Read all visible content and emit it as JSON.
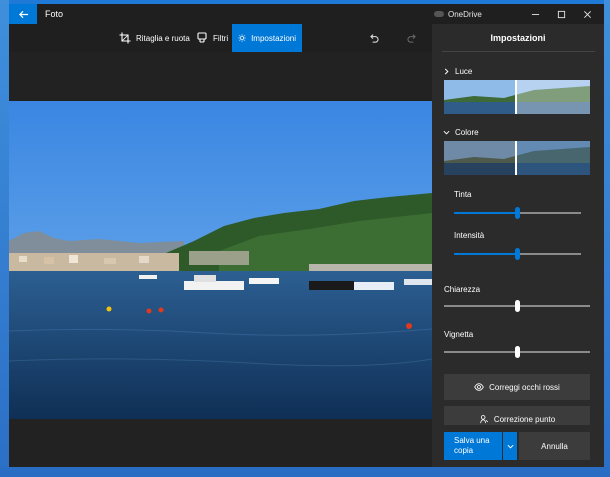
{
  "app": {
    "title": "Foto",
    "onedrive_label": "OneDrive"
  },
  "toolbar": {
    "crop_label": "Ritaglia e ruota",
    "filters_label": "Filtri",
    "adjust_label": "Impostazioni",
    "active_tool": "adjust"
  },
  "panel": {
    "title": "Impostazioni",
    "sections": {
      "light": {
        "label": "Luce",
        "expanded": false
      },
      "color": {
        "label": "Colore",
        "expanded": true
      }
    },
    "sliders": {
      "tint": {
        "label": "Tinta",
        "value": 0.5
      },
      "warmth": {
        "label": "Intensità",
        "value": 0.5
      },
      "clarity": {
        "label": "Chiarezza",
        "value": 0.5
      },
      "vignette": {
        "label": "Vignetta",
        "value": 0.5
      }
    },
    "buttons": {
      "red_eye": "Correggi occhi rossi",
      "spot_fix": "Correzione punto"
    },
    "footer": {
      "save_line1": "Salva una",
      "save_line2": "copia",
      "cancel": "Annulla"
    }
  },
  "colors": {
    "accent": "#0078d7",
    "panel_bg": "#2b2b2b",
    "titlebar_bg": "#1f1f1f"
  }
}
